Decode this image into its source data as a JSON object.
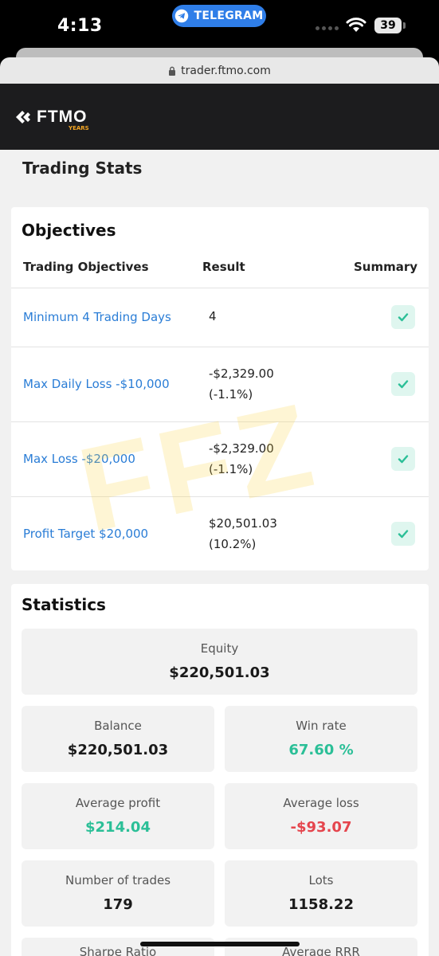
{
  "status_bar": {
    "time": "4:13",
    "telegram_label": "TELEGRAM",
    "battery": "39"
  },
  "browser": {
    "url": "trader.ftmo.com"
  },
  "header": {
    "logo_text": "FTMO",
    "logo_years": "YEARS",
    "accent_color": "#f5a623"
  },
  "page_title": "Trading Stats",
  "objectives": {
    "title": "Objectives",
    "columns": [
      "Trading Objectives",
      "Result",
      "Summary"
    ],
    "rows": [
      {
        "name": "Minimum 4 Trading Days",
        "result_line1": "4",
        "result_line2": ""
      },
      {
        "name": "Max Daily Loss -$10,000",
        "result_line1": "-$2,329.00",
        "result_line2": "(-1.1%)"
      },
      {
        "name": "Max Loss -$20,000",
        "result_line1": "-$2,329.00",
        "result_line2": "(-1.1%)"
      },
      {
        "name": "Profit Target $20,000",
        "result_line1": "$20,501.03",
        "result_line2": "(10.2%)"
      }
    ]
  },
  "statistics": {
    "title": "Statistics",
    "equity": {
      "label": "Equity",
      "value": "$220,501.03"
    },
    "balance": {
      "label": "Balance",
      "value": "$220,501.03"
    },
    "win_rate": {
      "label": "Win rate",
      "value": "67.60 %"
    },
    "avg_profit": {
      "label": "Average profit",
      "value": "$214.04"
    },
    "avg_loss": {
      "label": "Average loss",
      "value": "-$93.07"
    },
    "num_trades": {
      "label": "Number of trades",
      "value": "179"
    },
    "lots": {
      "label": "Lots",
      "value": "1158.22"
    },
    "sharpe": {
      "label": "Sharpe Ratio"
    },
    "avg_rrr": {
      "label": "Average RRR"
    }
  },
  "watermark": "FFZ",
  "colors": {
    "link_blue": "#2a7dd6",
    "positive_green": "#2bbf97",
    "negative_red": "#e5454d"
  }
}
